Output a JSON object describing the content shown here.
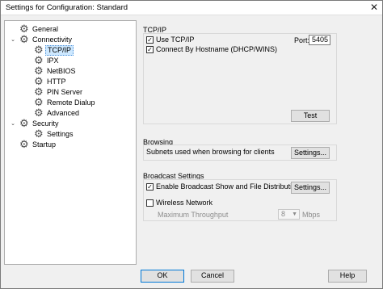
{
  "window": {
    "title": "Settings for Configuration: Standard",
    "close_glyph": "✕"
  },
  "tree": {
    "items": [
      {
        "label": "General",
        "icon": "gear-icon"
      },
      {
        "label": "Connectivity",
        "icon": "gear-icon",
        "expanded": true
      },
      {
        "label": "TCP/IP",
        "icon": "gear-icon",
        "selected": true
      },
      {
        "label": "IPX",
        "icon": "gear-icon"
      },
      {
        "label": "NetBIOS",
        "icon": "gear-icon"
      },
      {
        "label": "HTTP",
        "icon": "gear-icon"
      },
      {
        "label": "PIN Server",
        "icon": "gear-icon"
      },
      {
        "label": "Remote Dialup",
        "icon": "gear-icon"
      },
      {
        "label": "Advanced",
        "icon": "gear-icon"
      },
      {
        "label": "Security",
        "icon": "gear-icon",
        "expanded": true
      },
      {
        "label": "Settings",
        "icon": "gear-icon"
      },
      {
        "label": "Startup",
        "icon": "gear-icon"
      }
    ],
    "expand_glyph": "⌄"
  },
  "tcpip": {
    "section_label": "TCP/IP",
    "use_tcpip_label": "Use TCP/IP",
    "use_tcpip_checked": true,
    "connect_by_hostname_label": "Connect By Hostname (DHCP/WINS)",
    "connect_by_hostname_checked": true,
    "port_label": "Port:",
    "port_value": "5405",
    "test_button": "Test"
  },
  "browsing": {
    "section_label": "Browsing",
    "description": "Subnets used when browsing for clients",
    "settings_button": "Settings..."
  },
  "broadcast": {
    "section_label": "Broadcast Settings",
    "enable_label": "Enable Broadcast Show and File Distribution",
    "enable_checked": true,
    "settings_button": "Settings...",
    "wireless_label": "Wireless Network",
    "wireless_checked": false,
    "max_throughput_label": "Maximum Throughput",
    "max_throughput_value": "8",
    "max_throughput_unit": "Mbps"
  },
  "footer": {
    "ok_button": "OK",
    "cancel_button": "Cancel",
    "help_button": "Help"
  },
  "colors": {
    "selection_bg": "#cde8ff",
    "primary_border": "#0078d7"
  }
}
